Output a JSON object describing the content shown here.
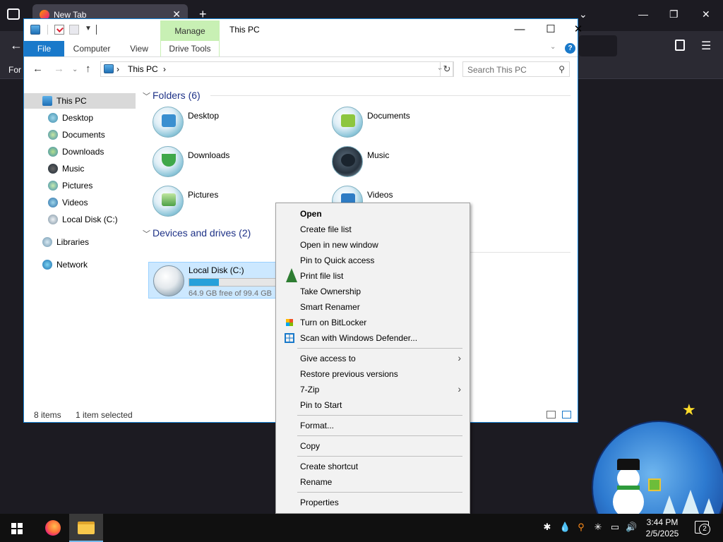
{
  "browser": {
    "tab_title": "New Tab",
    "bookmark_text": "For"
  },
  "window": {
    "title": "This PC",
    "manage_label": "Manage",
    "ribbon_tabs": [
      "File",
      "Computer",
      "View",
      "Drive Tools"
    ]
  },
  "address": {
    "location": "This PC",
    "search_placeholder": "Search This PC"
  },
  "navpane": {
    "items": [
      {
        "label": "This PC",
        "icon": "pc-icon",
        "selected": true
      },
      {
        "label": "Desktop",
        "icon": "desktop-icon"
      },
      {
        "label": "Documents",
        "icon": "documents-icon"
      },
      {
        "label": "Downloads",
        "icon": "downloads-icon"
      },
      {
        "label": "Music",
        "icon": "music-icon"
      },
      {
        "label": "Pictures",
        "icon": "pictures-icon"
      },
      {
        "label": "Videos",
        "icon": "videos-icon"
      },
      {
        "label": "Local Disk (C:)",
        "icon": "disk-icon"
      },
      {
        "label": "Libraries",
        "icon": "libraries-icon"
      },
      {
        "label": "Network",
        "icon": "network-icon"
      }
    ]
  },
  "folders": {
    "header": "Folders (6)",
    "items": [
      {
        "label": "Desktop"
      },
      {
        "label": "Documents"
      },
      {
        "label": "Downloads"
      },
      {
        "label": "Music"
      },
      {
        "label": "Pictures"
      },
      {
        "label": "Videos"
      }
    ]
  },
  "drives": {
    "header": "Devices and drives (2)",
    "local_disk": {
      "name": "Local Disk (C:)",
      "free_text": "64.9 GB free of 99.4 GB",
      "used_fraction": 0.347
    }
  },
  "status": {
    "items": "8 items",
    "selected": "1 item selected"
  },
  "context_menu": {
    "items": [
      {
        "label": "Open",
        "bold": true
      },
      {
        "label": "Create file list"
      },
      {
        "label": "Open in new window"
      },
      {
        "label": "Pin to Quick access"
      },
      {
        "label": "Print file list"
      },
      {
        "label": "Take Ownership"
      },
      {
        "label": "Smart Renamer"
      },
      {
        "label": "Turn on BitLocker",
        "icon": "bitlocker-icon"
      },
      {
        "label": "Scan with Windows Defender...",
        "icon": "defender-icon"
      },
      {
        "label": "Give access to",
        "submenu": true
      },
      {
        "label": "Restore previous versions"
      },
      {
        "label": "7-Zip",
        "submenu": true
      },
      {
        "label": "Pin to Start"
      },
      {
        "label": "Format..."
      },
      {
        "label": "Copy"
      },
      {
        "label": "Create shortcut"
      },
      {
        "label": "Rename"
      },
      {
        "label": "Properties"
      }
    ]
  },
  "taskbar": {
    "time": "3:44 PM",
    "date": "2/5/2025",
    "notification_count": "2"
  },
  "colors": {
    "accent": "#1979ca",
    "manage_bg": "#c8f0b4",
    "selection": "#cce8ff",
    "drive_fill": "#26a0da",
    "group_header": "#1e3287"
  }
}
